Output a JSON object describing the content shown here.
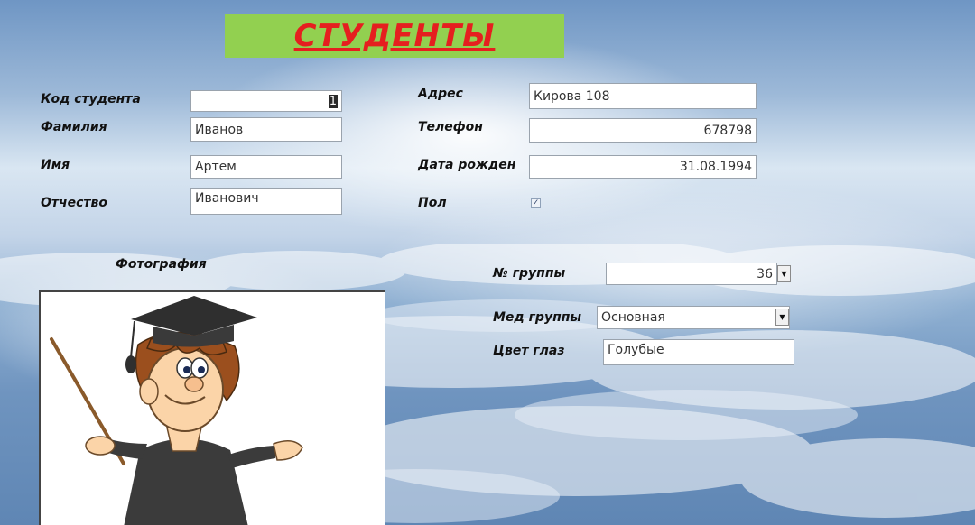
{
  "form": {
    "title": "СТУДЕНТЫ",
    "labels": {
      "student_code": "Код студента",
      "last_name": "Фамилия",
      "first_name": "Имя",
      "patronymic": "Отчество",
      "address": "Адрес",
      "phone": "Телефон",
      "birth_date": "Дата рожден",
      "gender": "Пол",
      "photo": "Фотография",
      "group_no": "№ группы",
      "med_group": "Мед группы",
      "eye_color": "Цвет глаз"
    },
    "values": {
      "student_code": "1",
      "last_name": "Иванов",
      "first_name": "Артем",
      "patronymic": "Иванович",
      "address": "Кирова 108",
      "phone": "678798",
      "birth_date": "31.08.1994",
      "gender_checked": true,
      "group_no": "36",
      "med_group": "Основная",
      "eye_color": "Голубые"
    }
  },
  "colors": {
    "title_bg": "#92d050",
    "title_text": "#e51f1f"
  },
  "icons": {
    "dropdown": "chevron-down-icon",
    "checkbox": "check-icon",
    "photo": "student-cartoon"
  }
}
